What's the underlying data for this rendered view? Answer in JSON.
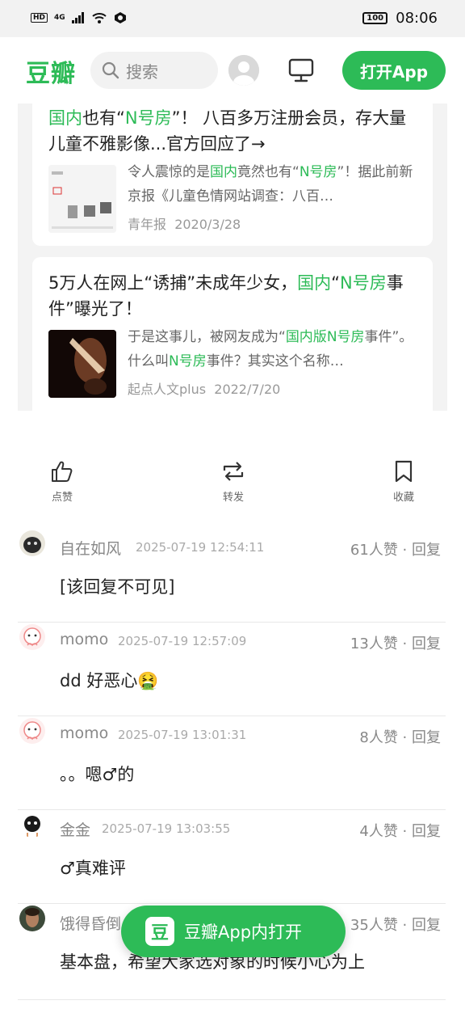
{
  "status": {
    "network": "4G",
    "hd": "HD",
    "battery": "100",
    "time": "08:06"
  },
  "nav": {
    "logo": "豆瓣",
    "search_placeholder": "搜索",
    "open_app": "打开App"
  },
  "cards": [
    {
      "title_parts": [
        "国内",
        "也有“",
        "N号房",
        "”！ 八百多万注册会员，存大量儿童不雅影像...官方回应了→"
      ],
      "desc_parts": [
        "令人震惊的是",
        "国内",
        "竟然也有“",
        "N号房",
        "”！据此前新京报《儿童色情网站调查：八百…"
      ],
      "source": "青年报",
      "date": "2020/3/28"
    },
    {
      "title_parts": [
        "5万人在网上“诱捕”未成年少女，",
        "国内",
        "“",
        "N号房",
        "事件”曝光了！"
      ],
      "desc_parts": [
        "于是这事儿，被网友成为“",
        "国内版",
        "N号房",
        "事件”。什么叫",
        "N号房",
        "事件？其实这个名称…"
      ],
      "source": "起点人文plus",
      "date": "2022/7/20"
    }
  ],
  "actions": {
    "like": "点赞",
    "repost": "转发",
    "collect": "收藏"
  },
  "comments": [
    {
      "name": "自在如风",
      "time": "2025-07-19 12:54:11",
      "likes": "61人赞",
      "reply": "回复",
      "text": "[该回复不可见]"
    },
    {
      "name": "momo",
      "time": "2025-07-19 12:57:09",
      "likes": "13人赞",
      "reply": "回复",
      "text": "dd 好恶心🤮"
    },
    {
      "name": "momo",
      "time": "2025-07-19 13:01:31",
      "likes": "8人赞",
      "reply": "回复",
      "text": "。。嗯♂的"
    },
    {
      "name": "金金",
      "time": "2025-07-19 13:03:55",
      "likes": "4人赞",
      "reply": "回复",
      "text": "♂真难评"
    },
    {
      "name": "饿得昏倒",
      "time": "",
      "likes": "35人赞",
      "reply": "回复",
      "text": "基本盘，希望大家选对象的时候小心为上"
    }
  ],
  "float_button": {
    "icon_text": "豆",
    "label": "豆瓣App内打开"
  }
}
